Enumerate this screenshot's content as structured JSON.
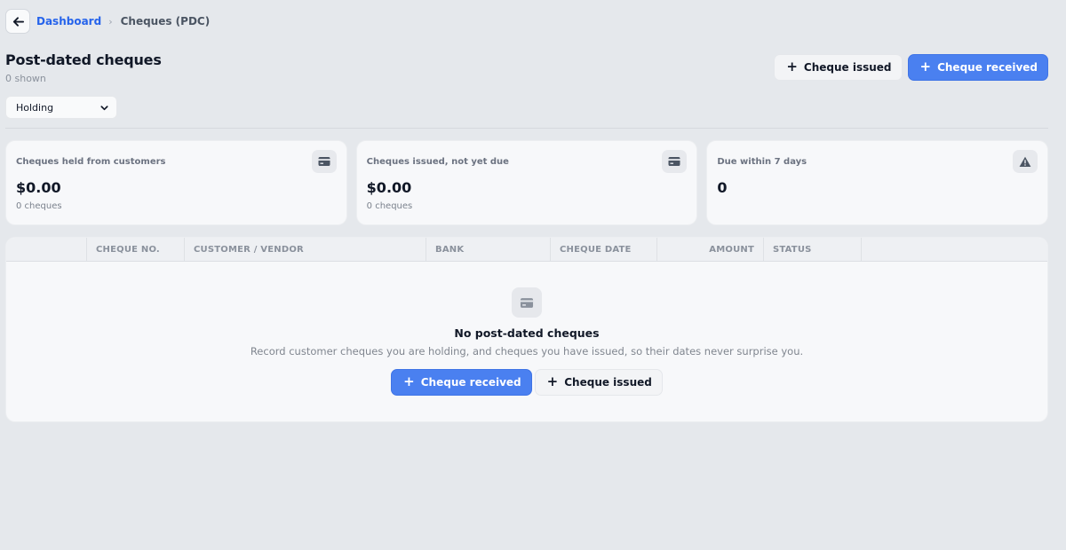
{
  "breadcrumb": {
    "parent": "Dashboard",
    "separator": "›",
    "current": "Cheques (PDC)"
  },
  "header": {
    "title": "Post-dated cheques",
    "shown": "0 shown",
    "issued_label": "Cheque issued",
    "received_label": "Cheque received"
  },
  "filter": {
    "selected": "Holding"
  },
  "stats": [
    {
      "label": "Cheques held from customers",
      "value": "$0.00",
      "note": "0 cheques",
      "icon": "card-icon"
    },
    {
      "label": "Cheques issued, not yet due",
      "value": "$0.00",
      "note": "0 cheques",
      "icon": "card-icon"
    },
    {
      "label": "Due within 7 days",
      "value": "0",
      "note": "",
      "icon": "warning-icon"
    }
  ],
  "table": {
    "columns": [
      "",
      "CHEQUE NO.",
      "CUSTOMER / VENDOR",
      "BANK",
      "CHEQUE DATE",
      "AMOUNT",
      "STATUS",
      ""
    ]
  },
  "empty": {
    "title": "No post-dated cheques",
    "description": "Record customer cheques you are holding, and cheques you have issued, so their dates never surprise you.",
    "received_label": "Cheque received",
    "issued_label": "Cheque issued"
  },
  "colors": {
    "accent": "#4a80f0",
    "link": "#2563eb",
    "background": "#e5e8ec"
  }
}
